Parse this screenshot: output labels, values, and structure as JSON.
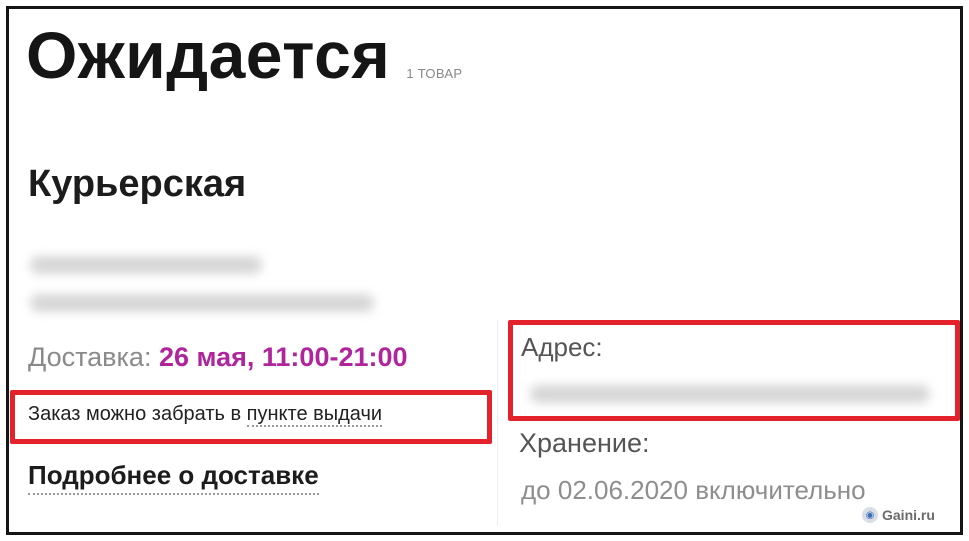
{
  "header": {
    "title": "Ожидается",
    "item_count": "1 ТОВАР"
  },
  "delivery": {
    "type_title": "Курьерская",
    "label": "Доставка:",
    "datetime": "26 мая, 11:00-21:00",
    "pickup_note_a": "Заказ можно забрать в ",
    "pickup_note_b": "пункте выдачи",
    "more_link": "Подробнее о доставке"
  },
  "pickup_point": {
    "address_label": "Адрес:",
    "storage_label": "Хранение:",
    "storage_value": "до 02.06.2020 включительно"
  },
  "watermark": {
    "text": "Gaini.ru",
    "icon": "globe-icon"
  },
  "colors": {
    "accent": "#b0259c",
    "highlight": "#e3222b"
  }
}
